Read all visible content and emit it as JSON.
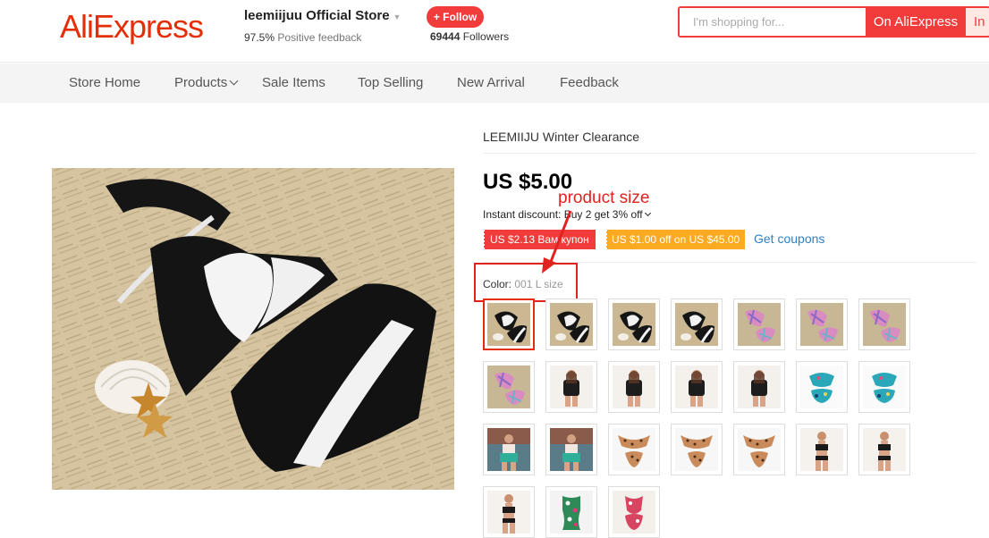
{
  "header": {
    "logo": "AliExpress",
    "store_name": "leemiijuu Official Store",
    "feedback_percent": "97.5%",
    "feedback_label": "Positive feedback",
    "follow_label": "+ Follow",
    "followers_count": "69444",
    "followers_label": "Followers",
    "search_placeholder": "I'm shopping for...",
    "search_button": "On AliExpress",
    "search_button_secondary": "In"
  },
  "nav": {
    "items": [
      {
        "label": "Store Home"
      },
      {
        "label": "Products",
        "has_dropdown": true
      },
      {
        "label": "Sale Items"
      },
      {
        "label": "Top Selling"
      },
      {
        "label": "New Arrival"
      },
      {
        "label": "Feedback"
      }
    ]
  },
  "product": {
    "title": "LEEMIIJU Winter Clearance",
    "price": "US $5.00",
    "discount_prefix": "Instant discount:",
    "discount_text": "Buy 2 get 3% off",
    "coupons": [
      {
        "label": "US $2.13 Вам купон",
        "color": "#f23b3b"
      },
      {
        "label": "US $1.00 off on US $45.00",
        "color": "#fcaa22"
      }
    ],
    "get_coupons": "Get coupons",
    "color_label": "Color:",
    "color_value": "001 L size",
    "swatches": [
      {
        "variant": "black-white-bikini",
        "selected": true
      },
      {
        "variant": "black-white-bikini"
      },
      {
        "variant": "black-white-bikini"
      },
      {
        "variant": "black-white-bikini"
      },
      {
        "variant": "pink-plaid-bikini"
      },
      {
        "variant": "pink-plaid-bikini"
      },
      {
        "variant": "pink-plaid-bikini"
      },
      {
        "variant": "pink-plaid-bikini"
      },
      {
        "variant": "black-tankini-model"
      },
      {
        "variant": "black-tankini-model"
      },
      {
        "variant": "black-tankini-model"
      },
      {
        "variant": "black-tankini-model"
      },
      {
        "variant": "blue-floral-bikini"
      },
      {
        "variant": "blue-floral-bikini"
      },
      {
        "variant": "teal-model-photo"
      },
      {
        "variant": "teal-model-photo"
      },
      {
        "variant": "leopard-bikini"
      },
      {
        "variant": "leopard-bikini"
      },
      {
        "variant": "leopard-bikini"
      },
      {
        "variant": "black-bikini-model"
      },
      {
        "variant": "black-bikini-model"
      },
      {
        "variant": "black-bikini-model"
      },
      {
        "variant": "green-print-swimsuit"
      },
      {
        "variant": "red-print-swimsuit"
      }
    ]
  },
  "annotation": {
    "label": "product size",
    "color": "#e0231e"
  },
  "colors": {
    "brand": "#e62e04",
    "accent": "#f23b3b",
    "link": "#2e7fc7",
    "coupon_orange": "#fcaa22"
  }
}
